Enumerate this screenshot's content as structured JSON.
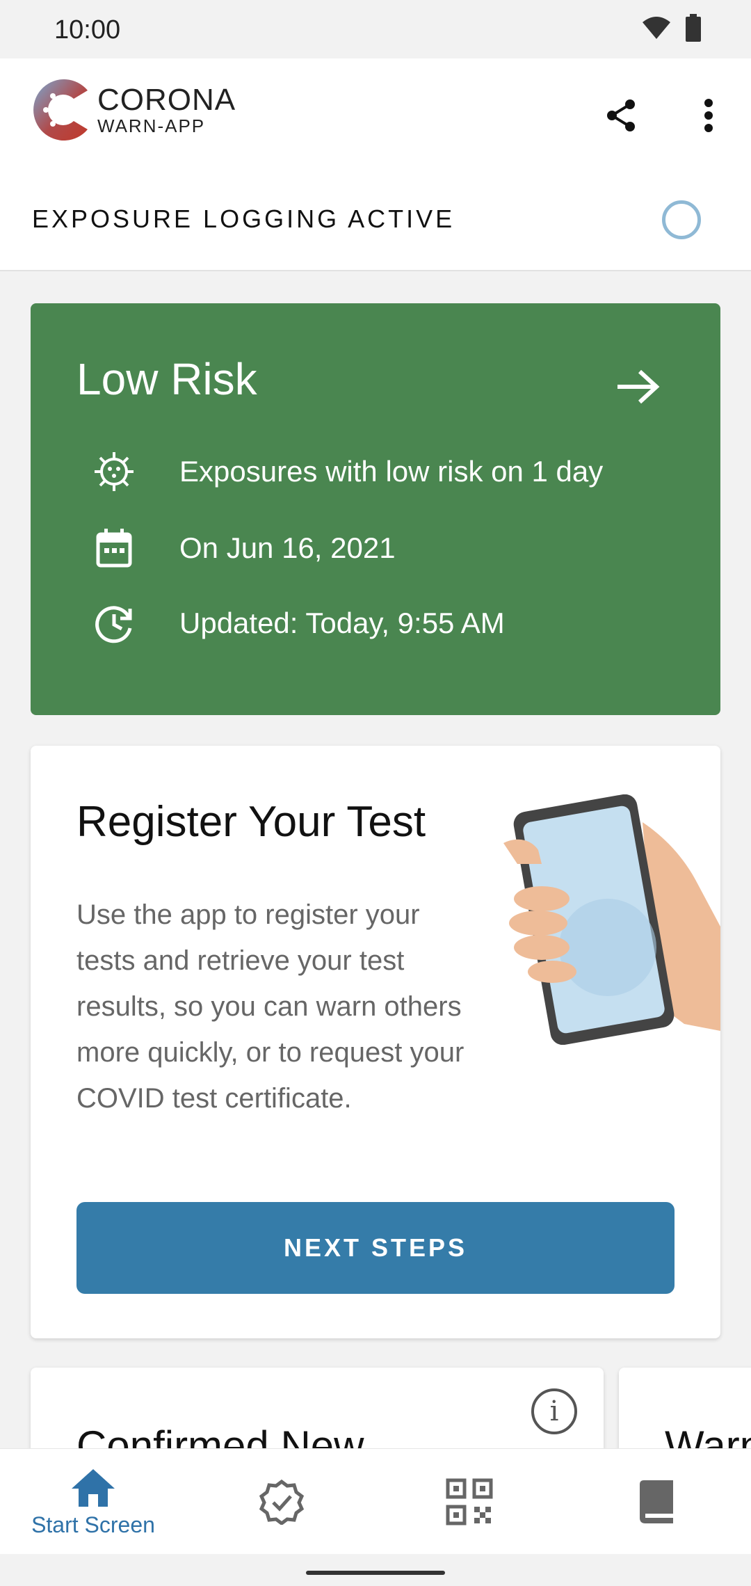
{
  "status_bar": {
    "time": "10:00",
    "icons": [
      "wifi-icon",
      "battery-icon"
    ]
  },
  "app_bar": {
    "logo_line1": "CORONA",
    "logo_line2": "WARN-APP",
    "share_icon": "share-icon",
    "menu_icon": "more-vert-icon",
    "logging_status": "EXPOSURE LOGGING ACTIVE"
  },
  "risk_card": {
    "title": "Low Risk",
    "color": "#4a8650",
    "rows": [
      {
        "icon": "virus-icon",
        "text": "Exposures with low risk on 1 day"
      },
      {
        "icon": "calendar-icon",
        "text": "On Jun 16, 2021"
      },
      {
        "icon": "clock-refresh-icon",
        "text": "Updated: Today, 9:55 AM"
      }
    ]
  },
  "test_card": {
    "title": "Register Your Test",
    "body": "Use the app to register your tests and retrieve your test results, so you can warn others more quickly, or to request your COVID test certificate.",
    "button": "NEXT STEPS",
    "button_color": "#357ca9"
  },
  "small_cards": [
    {
      "title": "Confirmed New"
    },
    {
      "title": "Warn"
    }
  ],
  "bottom_nav": {
    "items": [
      {
        "label": "Start Screen",
        "icon": "home-icon",
        "active": true
      },
      {
        "label": "",
        "icon": "certificate-badge-icon",
        "active": false
      },
      {
        "label": "",
        "icon": "qr-code-icon",
        "active": false
      },
      {
        "label": "",
        "icon": "diary-book-icon",
        "active": false
      }
    ],
    "active_color": "#2f72a8"
  }
}
